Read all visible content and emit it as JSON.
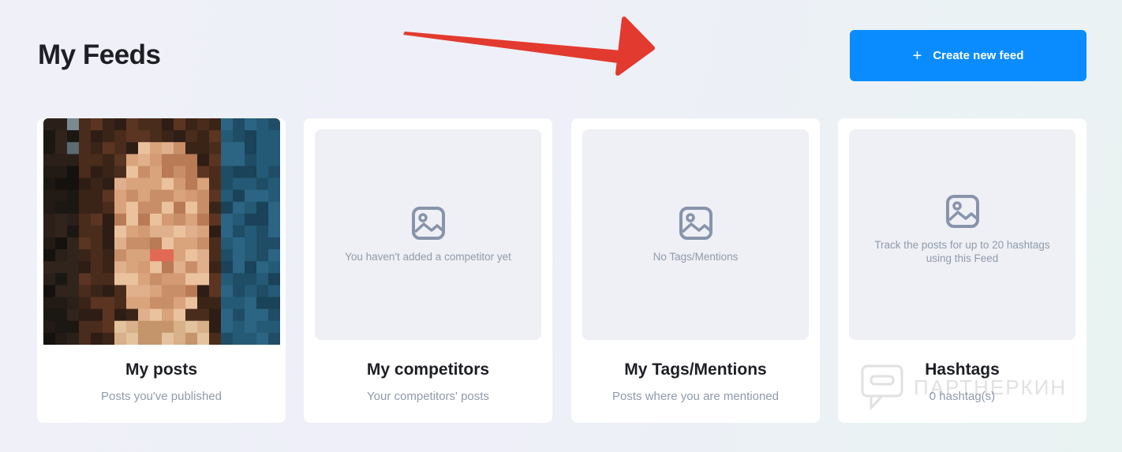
{
  "page": {
    "title": "My Feeds"
  },
  "toolbar": {
    "create_icon": "+",
    "create_label": "Create new feed"
  },
  "cards": [
    {
      "title": "My posts",
      "subtitle": "Posts you've published",
      "placeholder": ""
    },
    {
      "title": "My competitors",
      "subtitle": "Your competitors' posts",
      "placeholder": "You haven't added a competitor yet"
    },
    {
      "title": "My Tags/Mentions",
      "subtitle": "Posts where you are mentioned",
      "placeholder": "No Tags/Mentions"
    },
    {
      "title": "Hashtags",
      "subtitle": "0 hashtag(s)",
      "placeholder": "Track the posts for up to 20 hashtags using this Feed"
    }
  ],
  "watermark": {
    "text": "ПАРТНЕРКИН"
  },
  "colors": {
    "accent": "#0a8cff",
    "arrow": "#e23a2e",
    "muted_text": "#8f9aab",
    "placeholder_bg": "#eff0f5"
  },
  "icons": {
    "placeholder": "image-placeholder-icon",
    "arrow": "red-arrow-annotation"
  }
}
